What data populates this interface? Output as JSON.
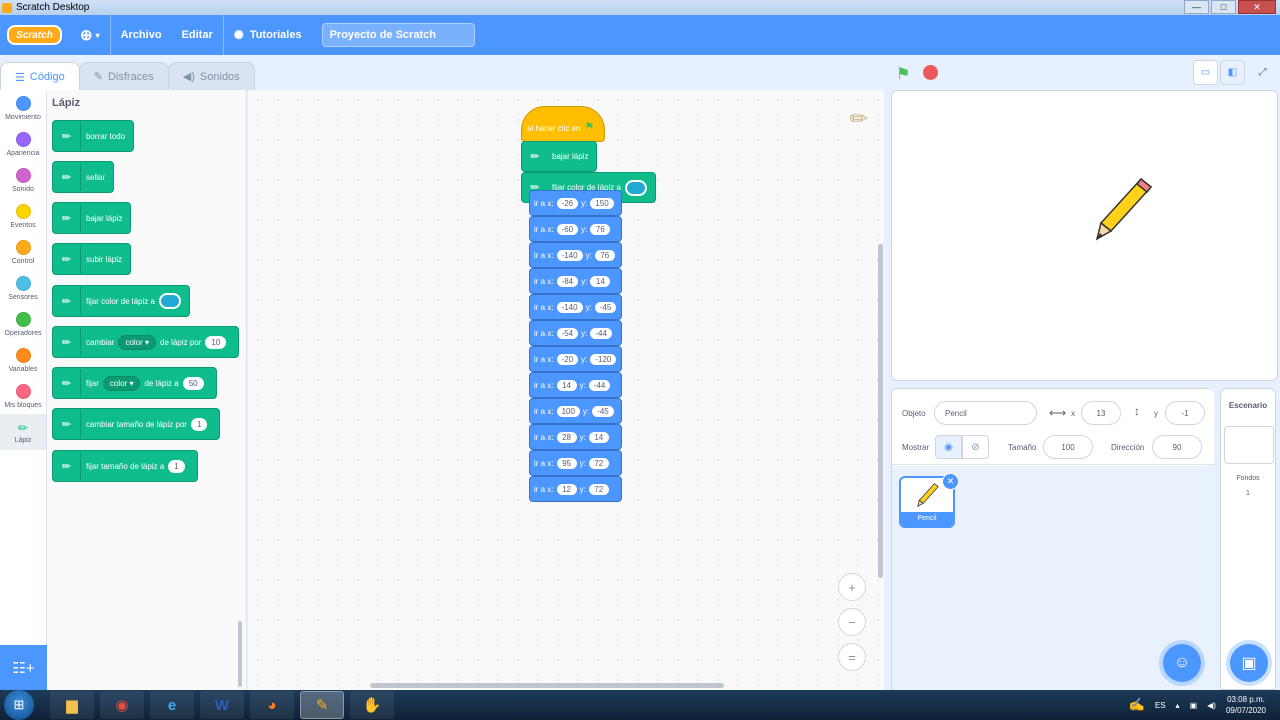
{
  "window": {
    "title": "Scratch Desktop",
    "min": "—",
    "max": "□",
    "close": "✕"
  },
  "menubar": {
    "logo": "Scratch",
    "globe_icon": "globe-icon",
    "file": "Archivo",
    "edit": "Editar",
    "tutorials": "Tutoriales",
    "project_title": "Proyecto de Scratch"
  },
  "tabs": [
    {
      "label": "Código",
      "icon": "code-icon"
    },
    {
      "label": "Disfraces",
      "icon": "brush-icon"
    },
    {
      "label": "Sonidos",
      "icon": "speaker-icon"
    }
  ],
  "categories": [
    {
      "label": "Movimiento",
      "color": "#4c97ff"
    },
    {
      "label": "Apariencia",
      "color": "#9966ff"
    },
    {
      "label": "Sonido",
      "color": "#cf63cf"
    },
    {
      "label": "Eventos",
      "color": "#ffd500"
    },
    {
      "label": "Control",
      "color": "#ffab19"
    },
    {
      "label": "Sensores",
      "color": "#4cbfe6"
    },
    {
      "label": "Operadores",
      "color": "#40bf4a"
    },
    {
      "label": "Variables",
      "color": "#ff8c1a"
    },
    {
      "label": "Mis bloques",
      "color": "#ff6680"
    },
    {
      "label": "Lápiz",
      "color": "#0fbd8c"
    }
  ],
  "palette": {
    "title": "Lápiz",
    "blocks": {
      "clear": "borrar todo",
      "stamp": "sellar",
      "pen_down": "bajar lápiz",
      "pen_up": "subir lápiz",
      "set_color_to": "fijar color de lápiz a",
      "change_pre": "cambiar",
      "change_dd": "color",
      "change_post": "de lápiz por",
      "change_val": "10",
      "set_pre": "fijar",
      "set_dd": "color",
      "set_post": "de lápiz a",
      "set_val": "50",
      "change_size": "cambiar tamaño de lápiz por",
      "change_size_val": "1",
      "set_size": "fijar tamaño de lápiz a",
      "set_size_val": "1"
    }
  },
  "script": {
    "hat": "al hacer clic en",
    "pen_down": "bajar lápiz",
    "set_color": "fijar color de lápiz a",
    "goto_label": "ir a x:",
    "y_label": "y:",
    "goto": [
      {
        "x": "-26",
        "y": "150"
      },
      {
        "x": "-60",
        "y": "76"
      },
      {
        "x": "-140",
        "y": "76"
      },
      {
        "x": "-84",
        "y": "14"
      },
      {
        "x": "-140",
        "y": "-45"
      },
      {
        "x": "-54",
        "y": "-44"
      },
      {
        "x": "-20",
        "y": "-120"
      },
      {
        "x": "14",
        "y": "-44"
      },
      {
        "x": "100",
        "y": "-45"
      },
      {
        "x": "28",
        "y": "14"
      },
      {
        "x": "95",
        "y": "72"
      },
      {
        "x": "12",
        "y": "72"
      }
    ]
  },
  "zoom": {
    "in": "+",
    "out": "−",
    "reset": "="
  },
  "sprite_info": {
    "object_label": "Objeto",
    "object_name": "Pencil",
    "x_label": "x",
    "x_value": "13",
    "y_label": "y",
    "y_value": "-1",
    "show_label": "Mostrar",
    "size_label": "Tamaño",
    "size_value": "100",
    "direction_label": "Dirección",
    "direction_value": "90"
  },
  "sprites": [
    {
      "name": "Pencil"
    }
  ],
  "backdrop": {
    "title": "Escenario",
    "backdrops_label": "Fondos",
    "backdrops_count": "1"
  },
  "taskbar": {
    "lang": "ES",
    "time": "03:08 p.m.",
    "date": "09/07/2020"
  }
}
